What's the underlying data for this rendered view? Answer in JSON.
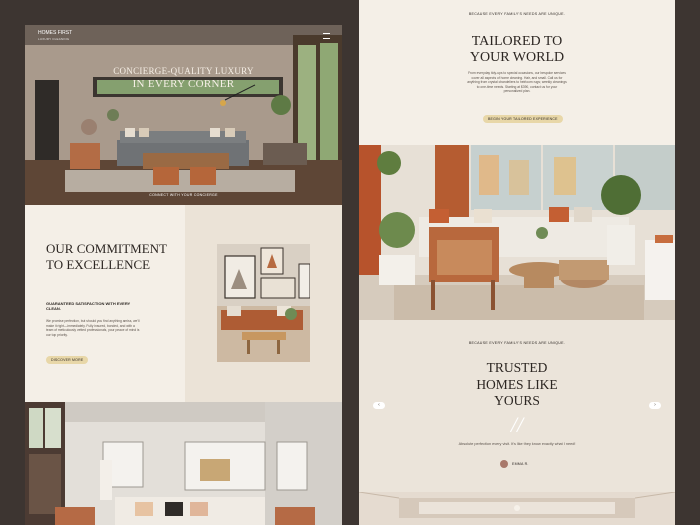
{
  "hero": {
    "brand": "HOMES FIRST",
    "brand_sub": "LUXURY CLEANING",
    "title_line1": "CONCIERGE-QUALITY LUXURY",
    "title_line2": "IN EVERY CORNER",
    "cta": "CONNECT WITH YOUR CONCIERGE"
  },
  "commitment": {
    "title": "OUR COMMITMENT TO EXCELLENCE",
    "subtitle": "GUARANTEED SATISFACTION WITH EVERY CLEAN.",
    "body": "We promise perfection, but should you find anything amiss, we'll make it right—immediately. Fully insured, bonded, and with a team of meticulously vetted professionals, your peace of mind is our top priority.",
    "button": "DISCOVER MORE"
  },
  "tailored": {
    "eyebrow": "BECAUSE EVERY FAMILY'S NEEDS ARE UNIQUE.",
    "title": "TAILORED TO YOUR WORLD",
    "body": "From everyday tidy-ups to special occasions, our bespoke services cover all aspects of home cleaning. Hair, and small. Call us for anything from crystal chandeliers to heirloom rugs; weekly cleanings to one-time needs. Starting at $390, contact us for your personalized plan.",
    "button": "BEGIN YOUR TAILORED EXPERIENCE"
  },
  "trusted": {
    "eyebrow": "BECAUSE EVERY FAMILY'S NEEDS ARE UNIQUE.",
    "title": "TRUSTED HOMES LIKE YOURS",
    "prev": "‹",
    "next": "›",
    "quote_mark": "//",
    "quote": "Absolute perfection every visit. It's like they know exactly what I need!",
    "author": "EMMA R."
  },
  "colors": {
    "background": "#3d3531",
    "cream": "#f4efe7",
    "accent_pill": "#e8d7a8",
    "text_dark": "#2c2622"
  }
}
